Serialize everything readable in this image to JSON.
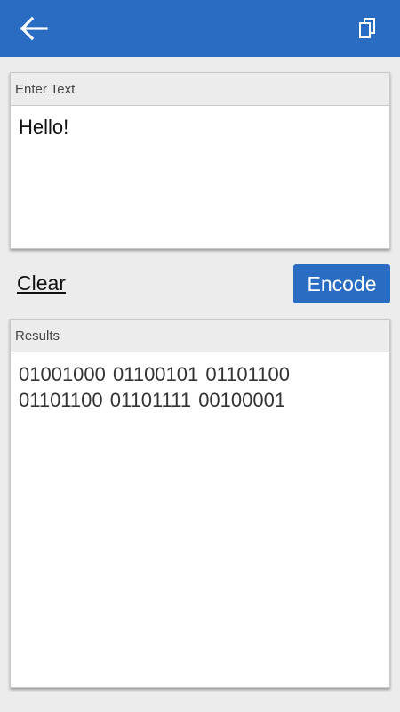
{
  "appbar": {
    "back_icon": "arrow-left-icon",
    "copy_icon": "copy-icon",
    "background_color": "#2a6cc2"
  },
  "input_panel": {
    "header": "Enter Text",
    "value": "Hello!"
  },
  "actions": {
    "clear_label": "Clear",
    "encode_label": "Encode",
    "accent_color": "#2a6cc2"
  },
  "results_panel": {
    "header": "Results",
    "lines": [
      "01001000 01100101 01101100",
      "01101100 01101111 00100001"
    ]
  }
}
